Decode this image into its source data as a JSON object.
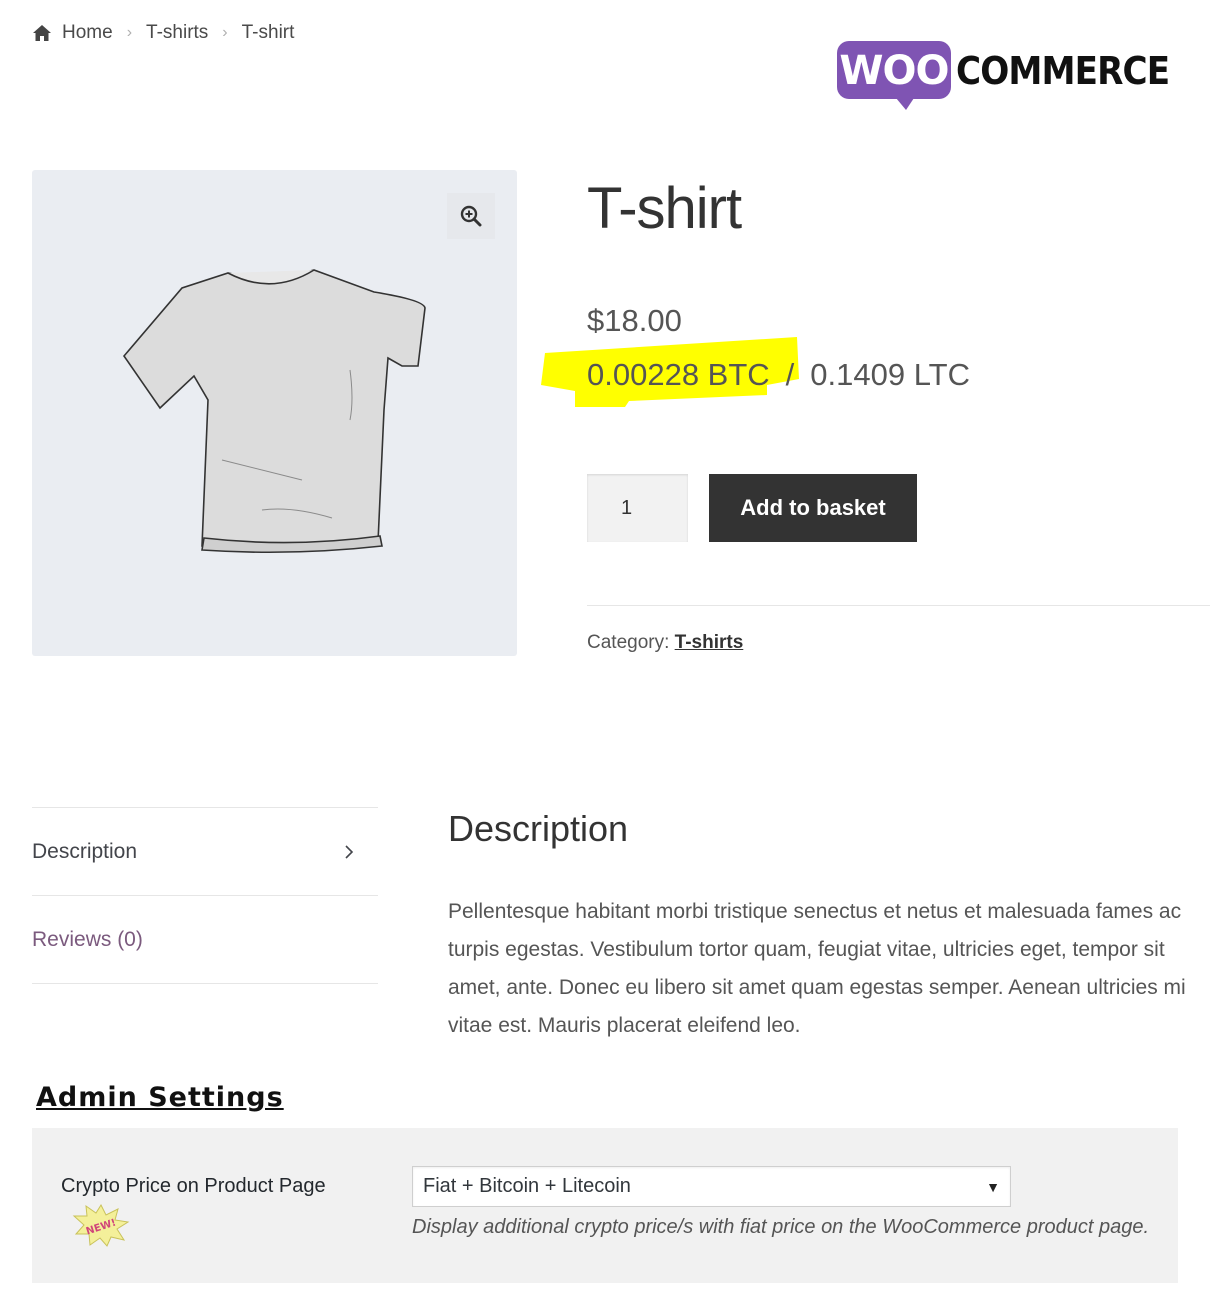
{
  "breadcrumb": {
    "icon": "home-icon",
    "items": [
      "Home",
      "T-shirts",
      "T-shirt"
    ]
  },
  "logo": {
    "woo": "WOO",
    "commerce": "COMMERCE",
    "brand_color": "#7f54b3"
  },
  "product": {
    "title": "T-shirt",
    "price_fiat": "$18.00",
    "price_btc": "0.00228 BTC",
    "price_separator": "/",
    "price_ltc": "0.1409 LTC",
    "highlight_color": "#ffff00",
    "quantity": "1",
    "add_button": "Add to basket",
    "category_label": "Category:",
    "category_link": "T-shirts"
  },
  "tabs": [
    {
      "label": "Description",
      "active": true
    },
    {
      "label": "Reviews (0)",
      "active": false
    }
  ],
  "description": {
    "heading": "Description",
    "body": "Pellentesque habitant morbi tristique senectus et netus et malesuada fames ac turpis egestas. Vestibulum tortor quam, feugiat vitae, ultricies eget, tempor sit amet, ante. Donec eu libero sit amet quam egestas semper. Aenean ultricies mi vitae est. Mauris placerat eleifend leo."
  },
  "admin": {
    "title": "Admin Settings",
    "setting_label": "Crypto Price on Product Page",
    "badge": "NEW!",
    "select_value": "Fiat + Bitcoin + Litecoin",
    "help_text": "Display additional crypto price/s with fiat price on the WooCommerce product page."
  }
}
